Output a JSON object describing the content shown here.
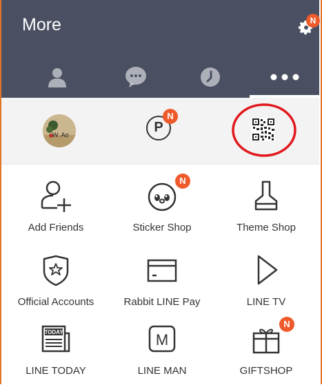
{
  "header": {
    "title": "More",
    "settings_badge": "N"
  },
  "tabs": [
    {
      "name": "friends",
      "icon": "person-icon",
      "active": false
    },
    {
      "name": "chats",
      "icon": "chat-bubble-icon",
      "active": false
    },
    {
      "name": "timeline",
      "icon": "clock-icon",
      "active": false
    },
    {
      "name": "more",
      "icon": "more-dots-icon",
      "active": true
    }
  ],
  "quick_actions": {
    "avatar_caption": "W. Ao",
    "points_letter": "P",
    "points_badge": "N"
  },
  "grid": {
    "items": [
      {
        "label": "Add Friends",
        "icon": "add-friend-icon",
        "badge": ""
      },
      {
        "label": "Sticker Shop",
        "icon": "sticker-icon",
        "badge": "N"
      },
      {
        "label": "Theme Shop",
        "icon": "brush-icon",
        "badge": ""
      },
      {
        "label": "Official Accounts",
        "icon": "official-shield-icon",
        "badge": ""
      },
      {
        "label": "Rabbit LINE Pay",
        "icon": "card-icon",
        "badge": ""
      },
      {
        "label": "LINE TV",
        "icon": "play-icon",
        "badge": ""
      },
      {
        "label": "LINE TODAY",
        "icon": "newspaper-icon",
        "badge": ""
      },
      {
        "label": "LINE MAN",
        "icon": "m-box-icon",
        "badge": ""
      },
      {
        "label": "GIFTSHOP",
        "icon": "gift-icon",
        "badge": "N"
      }
    ],
    "today_text": "TODAY",
    "man_letter": "M"
  },
  "colors": {
    "header": "#4a5062",
    "badge": "#ef5a2b",
    "highlight_circle": "#e0191e",
    "frame": "#e2742a"
  }
}
